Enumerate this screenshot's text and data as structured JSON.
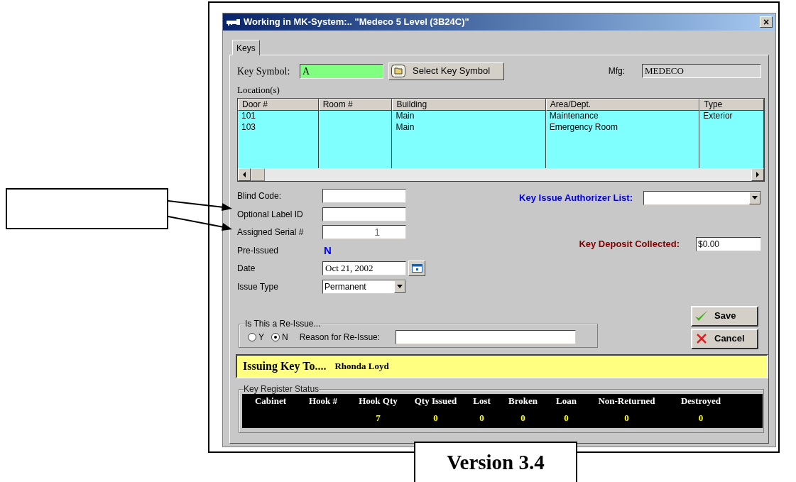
{
  "window": {
    "title": "Working in MK-System:.. \"Medeco 5 Level (3B24C)\"",
    "close": "×"
  },
  "tabs": [
    {
      "label": "Keys",
      "selected": true
    }
  ],
  "key_symbol": {
    "label": "Key Symbol:",
    "value": "A",
    "button": "Select Key Symbol"
  },
  "mfg": {
    "label": "Mfg:",
    "value": "MEDECO"
  },
  "locations": {
    "label": "Location(s)",
    "columns": [
      "Door #",
      "Room #",
      "Building",
      "Area/Dept.",
      "Type"
    ],
    "rows": [
      [
        "101",
        null,
        "Main",
        "Maintenance",
        "Exterior"
      ],
      [
        "103",
        null,
        "Main",
        "Emergency Room",
        null
      ]
    ]
  },
  "fields": [
    {
      "label": "Blind Code:",
      "kind": "text"
    },
    {
      "label": "Optional Label ID",
      "kind": "text"
    },
    {
      "label": "Assigned Serial #",
      "kind": "number",
      "value": "1"
    },
    {
      "label": "Pre-Issued",
      "kind": "flag",
      "value": "N"
    },
    {
      "label": "Date",
      "kind": "date",
      "value": "Oct 21, 2002"
    },
    {
      "label": "Issue Type",
      "kind": "select",
      "value": "Permanent"
    }
  ],
  "authorizer": {
    "label": "Key Issue Authorizer List:"
  },
  "deposit": {
    "label": "Key Deposit Collected:",
    "value": "$0.00"
  },
  "reissue": {
    "title": "Is This a Re-Issue...",
    "options": [
      {
        "label": "Y",
        "selected": false
      },
      {
        "label": "N",
        "selected": true
      }
    ],
    "reason_label": "Reason for Re-Issue:"
  },
  "buttons": [
    {
      "label": "Save",
      "kind": "save"
    },
    {
      "label": "Cancel",
      "kind": "cancel"
    }
  ],
  "issuing": {
    "label": "Issuing Key To....",
    "name": "Rhonda Loyd"
  },
  "register": {
    "title": "Key Register Status",
    "columns": [
      {
        "label": "Cabinet"
      },
      {
        "label": "Hook #"
      },
      {
        "label": "Hook Qty",
        "value": "7"
      },
      {
        "label": "Qty Issued",
        "value": "0"
      },
      {
        "label": "Lost",
        "value": "0"
      },
      {
        "label": "Broken",
        "value": "0"
      },
      {
        "label": "Loan",
        "value": "0"
      },
      {
        "label": "Non-Returned",
        "value": "0"
      },
      {
        "label": "Destroyed",
        "value": "0"
      }
    ]
  },
  "version": "Version 3.4"
}
